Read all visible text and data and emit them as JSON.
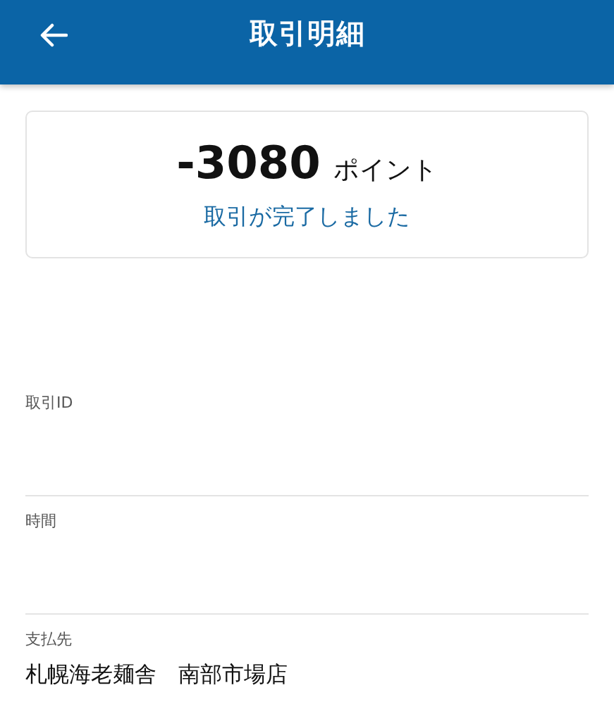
{
  "header": {
    "title": "取引明細"
  },
  "summary": {
    "amount": "-3080",
    "unit": "ポイント",
    "status": "取引が完了しました"
  },
  "fields": [
    {
      "label": "取引ID"
    },
    {
      "label": "時間"
    },
    {
      "label": "支払先",
      "value": "札幌海老麺舎　南部市場店"
    }
  ]
}
